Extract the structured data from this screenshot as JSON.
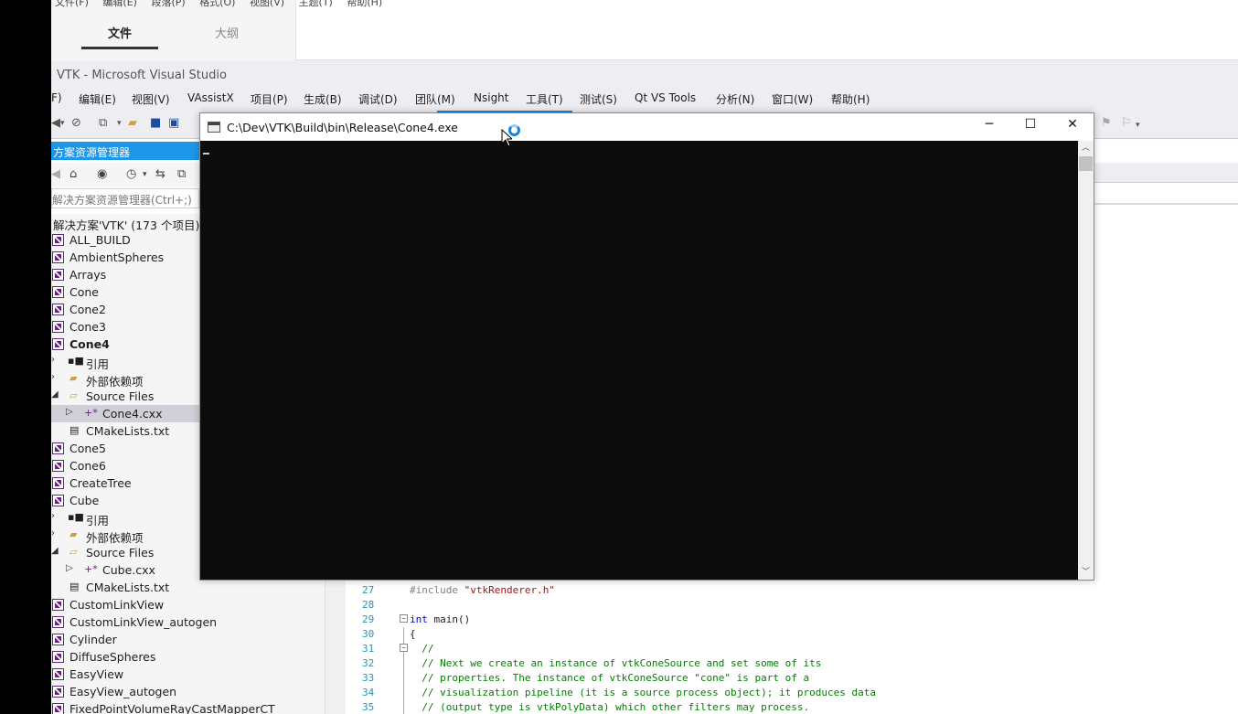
{
  "doc_editor": {
    "menu": [
      "文件(F)",
      "编辑(E)",
      "段落(P)",
      "格式(O)",
      "视图(V)",
      "主题(T)",
      "帮助(H)"
    ],
    "tabs": [
      {
        "label": "文件",
        "active": true
      },
      {
        "label": "大纲",
        "active": false
      }
    ]
  },
  "vs": {
    "title": "VTK - Microsoft Visual Studio",
    "menu": [
      "F)",
      "编辑(E)",
      "视图(V)",
      "VAssistX",
      "项目(P)",
      "生成(B)",
      "调试(D)",
      "团队(M)",
      "Nsight",
      "工具(T)",
      "测试(S)",
      "Qt VS Tools",
      "分析(N)",
      "窗口(W)",
      "帮助(H)"
    ],
    "accent": "#1c97ea"
  },
  "solution_explorer": {
    "header": "方案资源管理器",
    "search_placeholder": "解决方案资源管理器(Ctrl+;)",
    "root": "解决方案'VTK' (173 个项目)",
    "items": [
      {
        "label": "ALL_BUILD",
        "type": "project"
      },
      {
        "label": "AmbientSpheres",
        "type": "project"
      },
      {
        "label": "Arrays",
        "type": "project"
      },
      {
        "label": "Cone",
        "type": "project"
      },
      {
        "label": "Cone2",
        "type": "project"
      },
      {
        "label": "Cone3",
        "type": "project"
      },
      {
        "label": "Cone4",
        "type": "project",
        "bold": true
      },
      {
        "label": "引用",
        "type": "references"
      },
      {
        "label": "外部依赖项",
        "type": "folder"
      },
      {
        "label": "Source Files",
        "type": "folder-open"
      },
      {
        "label": "Cone4.cxx",
        "type": "cpp-file",
        "selected": true
      },
      {
        "label": "CMakeLists.txt",
        "type": "text-file"
      },
      {
        "label": "Cone5",
        "type": "project"
      },
      {
        "label": "Cone6",
        "type": "project"
      },
      {
        "label": "CreateTree",
        "type": "project"
      },
      {
        "label": "Cube",
        "type": "project"
      },
      {
        "label": "引用",
        "type": "references"
      },
      {
        "label": "外部依赖项",
        "type": "folder"
      },
      {
        "label": "Source Files",
        "type": "folder-open"
      },
      {
        "label": "Cube.cxx",
        "type": "cpp-file"
      },
      {
        "label": "CMakeLists.txt",
        "type": "text-file"
      },
      {
        "label": "CustomLinkView",
        "type": "project"
      },
      {
        "label": "CustomLinkView_autogen",
        "type": "project"
      },
      {
        "label": "Cylinder",
        "type": "project"
      },
      {
        "label": "DiffuseSpheres",
        "type": "project"
      },
      {
        "label": "EasyView",
        "type": "project"
      },
      {
        "label": "EasyView_autogen",
        "type": "project"
      },
      {
        "label": "FixedPointVolumeRayCastMapperCT",
        "type": "project"
      }
    ]
  },
  "console": {
    "title": "C:\\Dev\\VTK\\Build\\bin\\Release\\Cone4.exe",
    "minimize": "─",
    "maximize": "☐",
    "close": "✕"
  },
  "code": {
    "lines": [
      {
        "num": "27",
        "parts": [
          {
            "t": "#include ",
            "c": "c-pre"
          },
          {
            "t": "\"vtkRenderer.h\"",
            "c": "c-str"
          }
        ]
      },
      {
        "num": "28",
        "parts": []
      },
      {
        "num": "29",
        "parts": [
          {
            "t": "int",
            "c": "c-key"
          },
          {
            "t": " main()",
            "c": ""
          }
        ],
        "fold": "−"
      },
      {
        "num": "30",
        "parts": [
          {
            "t": "{",
            "c": ""
          }
        ]
      },
      {
        "num": "31",
        "parts": [
          {
            "t": "  //",
            "c": "c-cmt"
          }
        ],
        "fold": "−"
      },
      {
        "num": "32",
        "parts": [
          {
            "t": "  // Next we create an instance of vtkConeSource and set some of its",
            "c": "c-cmt"
          }
        ]
      },
      {
        "num": "33",
        "parts": [
          {
            "t": "  // properties. The instance of vtkConeSource \"cone\" is part of a",
            "c": "c-cmt"
          }
        ]
      },
      {
        "num": "34",
        "parts": [
          {
            "t": "  // visualization pipeline (it is a source process object); it produces data",
            "c": "c-cmt"
          }
        ]
      },
      {
        "num": "35",
        "parts": [
          {
            "t": "  // (output type is vtkPolyData) which other filters may process.",
            "c": "c-cmt"
          }
        ]
      }
    ]
  }
}
